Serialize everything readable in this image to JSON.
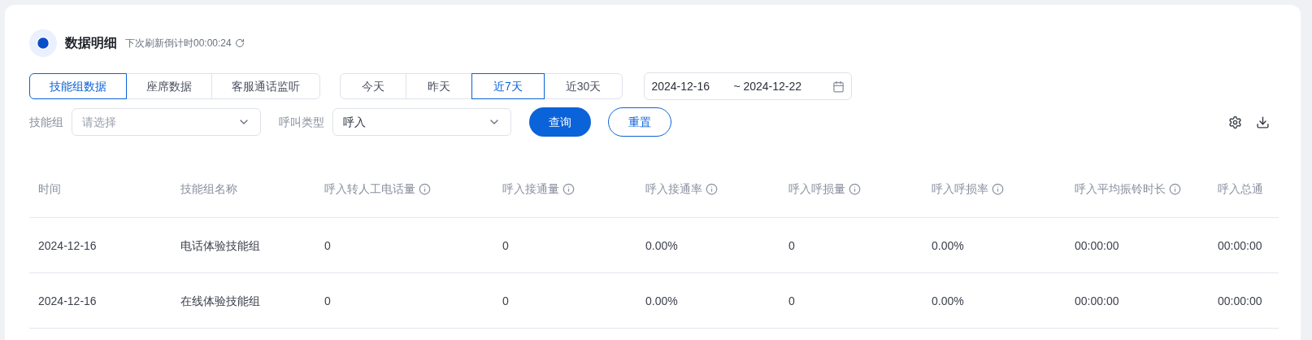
{
  "header": {
    "title": "数据明细",
    "countdown": "下次刷新倒计时00:00:24"
  },
  "data_tabs": [
    {
      "label": "技能组数据",
      "selected": true
    },
    {
      "label": "座席数据",
      "selected": false
    },
    {
      "label": "客服通话监听",
      "selected": false
    }
  ],
  "period_tabs": [
    {
      "label": "今天",
      "selected": false
    },
    {
      "label": "昨天",
      "selected": false
    },
    {
      "label": "近7天",
      "selected": true
    },
    {
      "label": "近30天",
      "selected": false
    }
  ],
  "date_range": {
    "start": "2024-12-16",
    "end": "~ 2024-12-22"
  },
  "filters": [
    {
      "label": "技能组",
      "placeholder": "请选择"
    },
    {
      "label": "呼叫类型",
      "value": "呼入"
    }
  ],
  "buttons": {
    "query": "查询",
    "reset": "重置"
  },
  "table": {
    "columns": [
      {
        "label": "时间",
        "kind": "plain"
      },
      {
        "label": "技能组名称",
        "kind": "plain"
      },
      {
        "label": "呼入转人工电话量",
        "kind": "info"
      },
      {
        "label": "呼入接通量",
        "kind": "info"
      },
      {
        "label": "呼入接通率",
        "kind": "info"
      },
      {
        "label": "呼入呼损量",
        "kind": "info"
      },
      {
        "label": "呼入呼损率",
        "kind": "info"
      },
      {
        "label": "呼入平均振铃时长",
        "kind": "info"
      },
      {
        "label": "呼入总通",
        "kind": "plain"
      }
    ],
    "rows": [
      [
        "2024-12-16",
        "电话体验技能组",
        "0",
        "0",
        "0.00%",
        "0",
        "0.00%",
        "00:00:00",
        "00:00:00"
      ],
      [
        "2024-12-16",
        "在线体验技能组",
        "0",
        "0",
        "0.00%",
        "0",
        "0.00%",
        "00:00:00",
        "00:00:00"
      ]
    ]
  }
}
